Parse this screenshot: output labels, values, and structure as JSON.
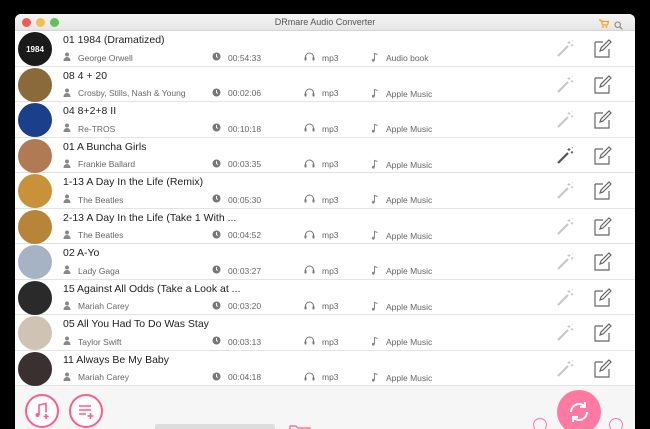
{
  "window": {
    "title": "DRmare Audio Converter"
  },
  "tracks": [
    {
      "title": "01 1984 (Dramatized)",
      "artist": "George Orwell",
      "duration": "00:54:33",
      "format": "mp3",
      "type": "Audio book",
      "cover_text": "1984",
      "cover_color": "#1a1a1a"
    },
    {
      "title": "08 4 + 20",
      "artist": "Crosby, Stills, Nash & Young",
      "duration": "00:02:06",
      "format": "mp3",
      "type": "Apple Music",
      "cover_text": "",
      "cover_color": "#8a6a3a"
    },
    {
      "title": "04 8+2+8  II",
      "artist": "Re-TROS",
      "duration": "00:10:18",
      "format": "mp3",
      "type": "Apple Music",
      "cover_text": "",
      "cover_color": "#1b3f8a"
    },
    {
      "title": "01 A Buncha Girls",
      "artist": "Frankie Ballard",
      "duration": "00:03:35",
      "format": "mp3",
      "type": "Apple Music",
      "cover_text": "",
      "cover_color": "#b07a54"
    },
    {
      "title": "1-13 A Day In the Life (Remix)",
      "artist": "The Beatles",
      "duration": "00:05:30",
      "format": "mp3",
      "type": "Apple Music",
      "cover_text": "",
      "cover_color": "#c8913a"
    },
    {
      "title": "2-13 A Day In the Life (Take 1 With ...",
      "artist": "The Beatles",
      "duration": "00:04:52",
      "format": "mp3",
      "type": "Apple Music",
      "cover_text": "",
      "cover_color": "#b8843a"
    },
    {
      "title": "02 A-Yo",
      "artist": "Lady Gaga",
      "duration": "00:03:27",
      "format": "mp3",
      "type": "Apple Music",
      "cover_text": "",
      "cover_color": "#a6b3c4"
    },
    {
      "title": "15 Against All Odds (Take a Look at ...",
      "artist": "Mariah Carey",
      "duration": "00:03:20",
      "format": "mp3",
      "type": "Apple Music",
      "cover_text": "",
      "cover_color": "#2a2a2a"
    },
    {
      "title": "05 All You Had To Do Was Stay",
      "artist": "Taylor Swift",
      "duration": "00:03:13",
      "format": "mp3",
      "type": "Apple Music",
      "cover_text": "",
      "cover_color": "#cfc4b4"
    },
    {
      "title": "11 Always Be My Baby",
      "artist": "Mariah Carey",
      "duration": "00:04:18",
      "format": "mp3",
      "type": "Apple Music",
      "cover_text": "",
      "cover_color": "#3a3030"
    }
  ],
  "colors": {
    "accent": "#ff5c8a",
    "icon_gray": "#999999",
    "cart": "#f0a020"
  }
}
